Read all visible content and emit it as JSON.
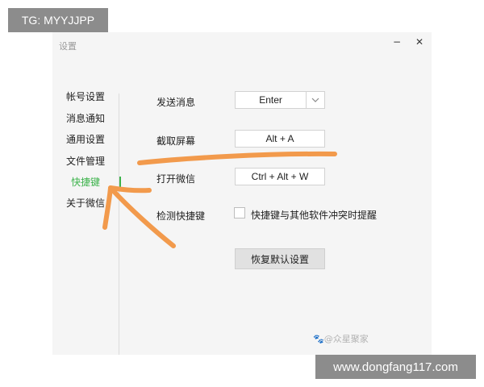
{
  "overlay": {
    "tag": "TG: MYYJJPP",
    "url": "www.dongfang117.com",
    "watermark": "众星聚家"
  },
  "window": {
    "title": "设置",
    "minimize_glyph": "−",
    "close_glyph": "✕"
  },
  "sidebar": {
    "items": [
      {
        "label": "帐号设置"
      },
      {
        "label": "消息通知"
      },
      {
        "label": "通用设置"
      },
      {
        "label": "文件管理"
      },
      {
        "label": "快捷键",
        "active": true
      },
      {
        "label": "关于微信"
      }
    ]
  },
  "shortcuts": {
    "rows": [
      {
        "label": "发送消息",
        "value": "Enter",
        "type": "dropdown"
      },
      {
        "label": "截取屏幕",
        "value": "Alt + A"
      },
      {
        "label": "打开微信",
        "value": "Ctrl + Alt + W"
      },
      {
        "label": "检测快捷键",
        "checkbox_label": "快捷键与其他软件冲突时提醒",
        "checked": false
      }
    ],
    "reset_label": "恢复默认设置"
  },
  "colors": {
    "accent": "#3bb24a",
    "annotation": "#f29a4c"
  }
}
